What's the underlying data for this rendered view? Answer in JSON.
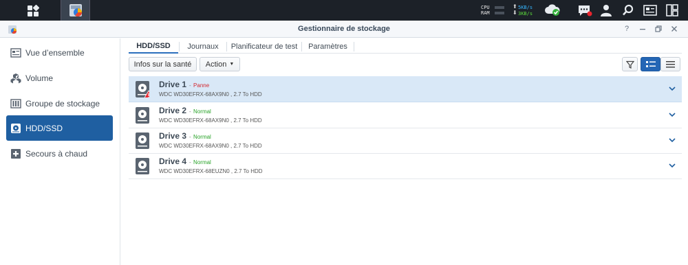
{
  "taskbar": {
    "resource_monitor": {
      "cpu_label": "CPU",
      "ram_label": "RAM",
      "upload": "5KB/s",
      "download": "3KB/s",
      "upload_color": "#35b6ff",
      "download_color": "#5cdb3c"
    }
  },
  "window": {
    "title": "Gestionnaire de stockage"
  },
  "sidebar": {
    "items": [
      {
        "label": "Vue d’ensemble",
        "icon": "overview-icon"
      },
      {
        "label": "Volume",
        "icon": "volume-icon"
      },
      {
        "label": "Groupe de stockage",
        "icon": "storage-pool-icon"
      },
      {
        "label": "HDD/SSD",
        "icon": "hdd-icon",
        "active": true
      },
      {
        "label": "Secours à chaud",
        "icon": "hot-spare-icon"
      }
    ]
  },
  "tabs": [
    {
      "label": "HDD/SSD",
      "active": true
    },
    {
      "label": "Journaux"
    },
    {
      "label": "Planificateur de test"
    },
    {
      "label": "Paramètres"
    }
  ],
  "toolbar": {
    "health_info_label": "Infos sur la santé",
    "action_label": "Action"
  },
  "drives": [
    {
      "name": "Drive 1",
      "separator": "-",
      "status": "Panne",
      "status_type": "fail",
      "description": "WDC WD30EFRX-68AX9N0 , 2.7 To HDD",
      "selected": true
    },
    {
      "name": "Drive 2",
      "separator": "-",
      "status": "Normal",
      "status_type": "ok",
      "description": "WDC WD30EFRX-68AX9N0 , 2.7 To HDD"
    },
    {
      "name": "Drive 3",
      "separator": "-",
      "status": "Normal",
      "status_type": "ok",
      "description": "WDC WD30EFRX-68AX9N0 , 2.7 To HDD"
    },
    {
      "name": "Drive 4",
      "separator": "-",
      "status": "Normal",
      "status_type": "ok",
      "description": "WDC WD30EFRX-68EUZN0 , 2.7 To HDD"
    }
  ],
  "colors": {
    "accent": "#1f5fa1",
    "failure": "#d3272e",
    "normal": "#29a329"
  }
}
